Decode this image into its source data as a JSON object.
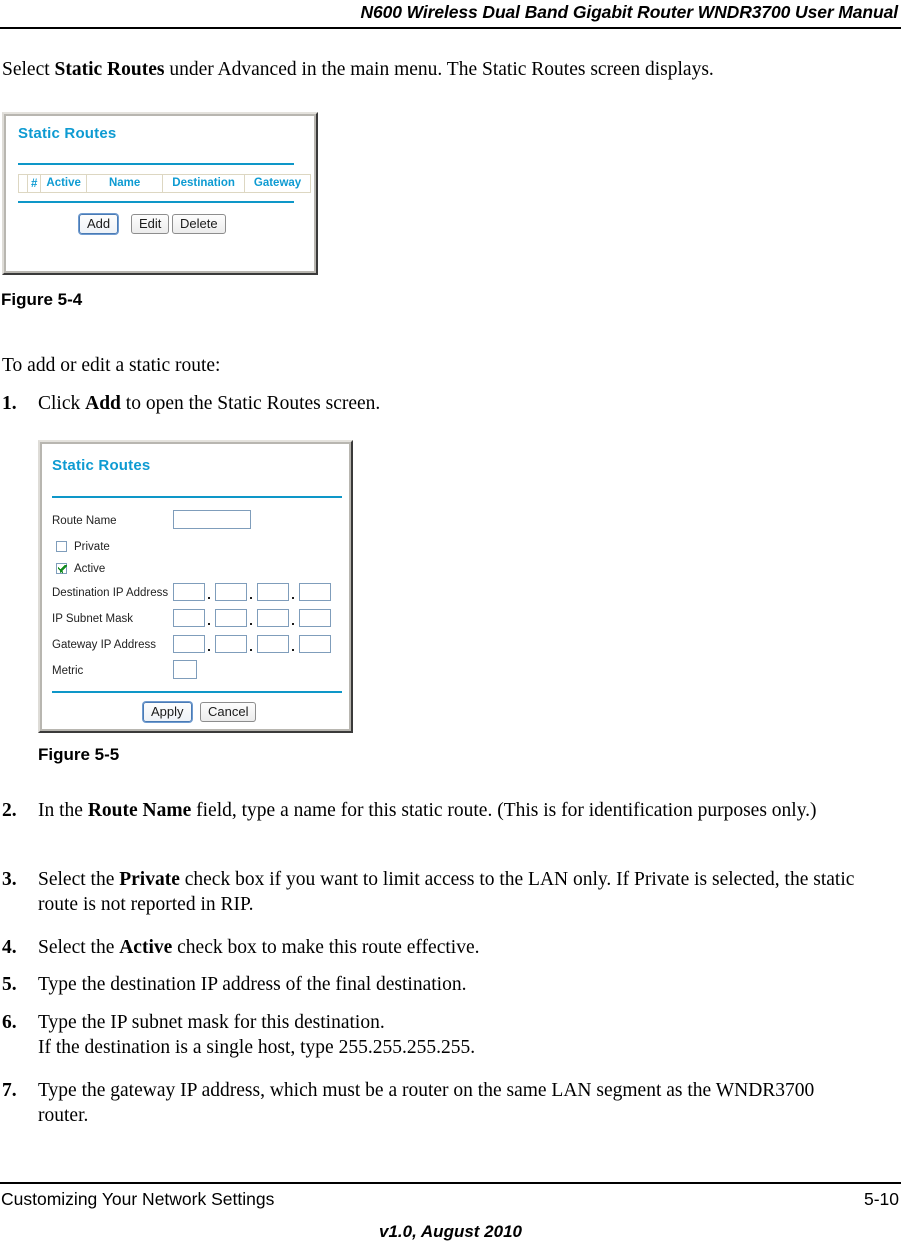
{
  "header": {
    "title": "N600 Wireless Dual Band Gigabit Router WNDR3700 User Manual"
  },
  "paragraphs": {
    "intro_a": "Select ",
    "intro_b": "Static Routes",
    "intro_c": " under Advanced in the main menu. The Static Routes screen displays.",
    "to_add": "To add or edit a static route:"
  },
  "figures": {
    "fig54_caption": "Figure 5-4",
    "fig55_caption": "Figure 5-5"
  },
  "screens": {
    "static_routes_list": {
      "title": "Static Routes",
      "table": {
        "headers": [
          "",
          "#",
          "Active",
          "Name",
          "Destination",
          "Gateway"
        ],
        "rows": []
      },
      "buttons": {
        "add": "Add",
        "edit": "Edit",
        "delete": "Delete"
      }
    },
    "static_routes_edit": {
      "title": "Static Routes",
      "fields": {
        "route_name_label": "Route Name",
        "route_name_value": "",
        "private_label": "Private",
        "private_checked": false,
        "active_label": "Active",
        "active_checked": true,
        "destination_ip_label": "Destination IP Address",
        "destination_ip_octets": [
          "",
          "",
          "",
          ""
        ],
        "subnet_mask_label": "IP Subnet Mask",
        "subnet_mask_octets": [
          "",
          "",
          "",
          ""
        ],
        "gateway_ip_label": "Gateway IP Address",
        "gateway_ip_octets": [
          "",
          "",
          "",
          ""
        ],
        "metric_label": "Metric",
        "metric_value": "",
        "octet_separator": "."
      },
      "buttons": {
        "apply": "Apply",
        "cancel": "Cancel"
      }
    }
  },
  "steps": [
    {
      "num": "1.",
      "parts": [
        {
          "t": "Click ",
          "b": false
        },
        {
          "t": "Add",
          "b": true
        },
        {
          "t": " to open the Static Routes screen.",
          "b": false
        }
      ]
    },
    {
      "num": "2.",
      "parts": [
        {
          "t": "In the ",
          "b": false
        },
        {
          "t": "Route Name",
          "b": true
        },
        {
          "t": " field, type a name for this static route. (This is for identification purposes only.)",
          "b": false
        }
      ]
    },
    {
      "num": "3.",
      "parts": [
        {
          "t": "Select the ",
          "b": false
        },
        {
          "t": "Private",
          "b": true
        },
        {
          "t": " check box if you want to limit access to the LAN only. If Private is selected, the static route is not reported in RIP.",
          "b": false
        }
      ]
    },
    {
      "num": "4.",
      "parts": [
        {
          "t": "Select the ",
          "b": false
        },
        {
          "t": "Active",
          "b": true
        },
        {
          "t": " check box to make this route effective.",
          "b": false
        }
      ]
    },
    {
      "num": "5.",
      "parts": [
        {
          "t": "Type the destination IP address of the final destination.",
          "b": false
        }
      ]
    },
    {
      "num": "6.",
      "parts": [
        {
          "t": "Type the IP subnet mask for this destination.",
          "b": false
        },
        {
          "t": "BREAK",
          "b": false
        },
        {
          "t": "If the destination is a single host, type 255.255.255.255.",
          "b": false
        }
      ]
    },
    {
      "num": "7.",
      "parts": [
        {
          "t": "Type the gateway IP address, which must be a router on the same LAN segment as the WNDR3700 router.",
          "b": false
        }
      ]
    }
  ],
  "footer": {
    "left": "Customizing Your Network Settings",
    "right": "5-10",
    "center": "v1.0, August 2010"
  },
  "colors": {
    "accent_cyan": "#0e9bd2",
    "rule_cyan": "#0e97c8",
    "check_green": "#128a1e",
    "table_border": "#ddd7c2"
  }
}
